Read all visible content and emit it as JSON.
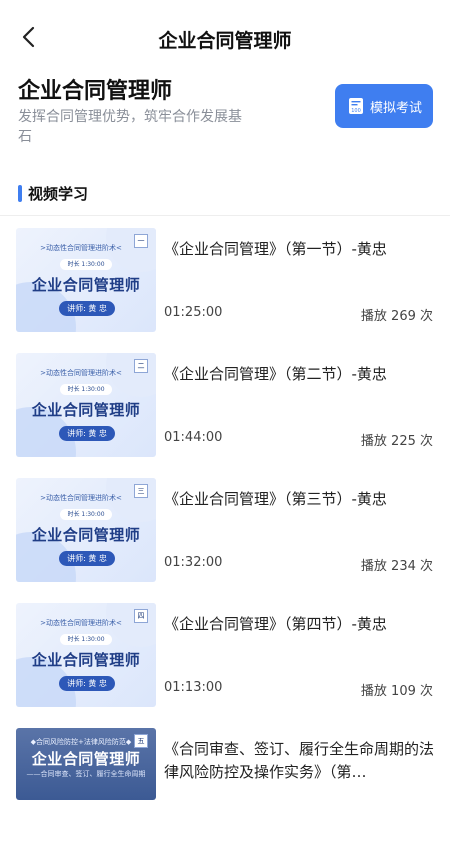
{
  "nav": {
    "title": "企业合同管理师"
  },
  "hero": {
    "title": "企业合同管理师",
    "subtitle": "发挥合同管理优势，筑牢合作发展基石",
    "exam_button": "模拟考试",
    "exam_icon_text": "100"
  },
  "section": {
    "title": "视频学习"
  },
  "videos": [
    {
      "title": "《企业合同管理》（第一节）-黄忠",
      "duration": "01:25:00",
      "plays": "播放 269 次",
      "thumb": {
        "sub": ">动态性合同管理进阶术<",
        "pill": "时长 1:30:00",
        "main": "企业合同管理师",
        "teacher": "讲师: 黄 忠",
        "num": "一"
      }
    },
    {
      "title": "《企业合同管理》（第二节）-黄忠",
      "duration": "01:44:00",
      "plays": "播放 225 次",
      "thumb": {
        "sub": ">动态性合同管理进阶术<",
        "pill": "时长 1:30:00",
        "main": "企业合同管理师",
        "teacher": "讲师: 黄 忠",
        "num": "二"
      }
    },
    {
      "title": "《企业合同管理》（第三节）-黄忠",
      "duration": "01:32:00",
      "plays": "播放 234 次",
      "thumb": {
        "sub": ">动态性合同管理进阶术<",
        "pill": "时长 1:30:00",
        "main": "企业合同管理师",
        "teacher": "讲师: 黄 忠",
        "num": "三"
      }
    },
    {
      "title": "《企业合同管理》（第四节）-黄忠",
      "duration": "01:13:00",
      "plays": "播放 109 次",
      "thumb": {
        "sub": ">动态性合同管理进阶术<",
        "pill": "时长 1:30:00",
        "main": "企业合同管理师",
        "teacher": "讲师: 黄 忠",
        "num": "四"
      }
    },
    {
      "title": "《合同审查、签订、履行全生命周期的法律风险防控及操作实务》（第…",
      "thumb": {
        "sub": "◆合同风险防控+法律风险防范◆",
        "main": "企业合同管理师",
        "sub2": "——合同审查、签订、履行全生命周期",
        "num": "五"
      }
    }
  ],
  "colors": {
    "accent": "#3f7ef0",
    "muted": "#8a8f99"
  }
}
